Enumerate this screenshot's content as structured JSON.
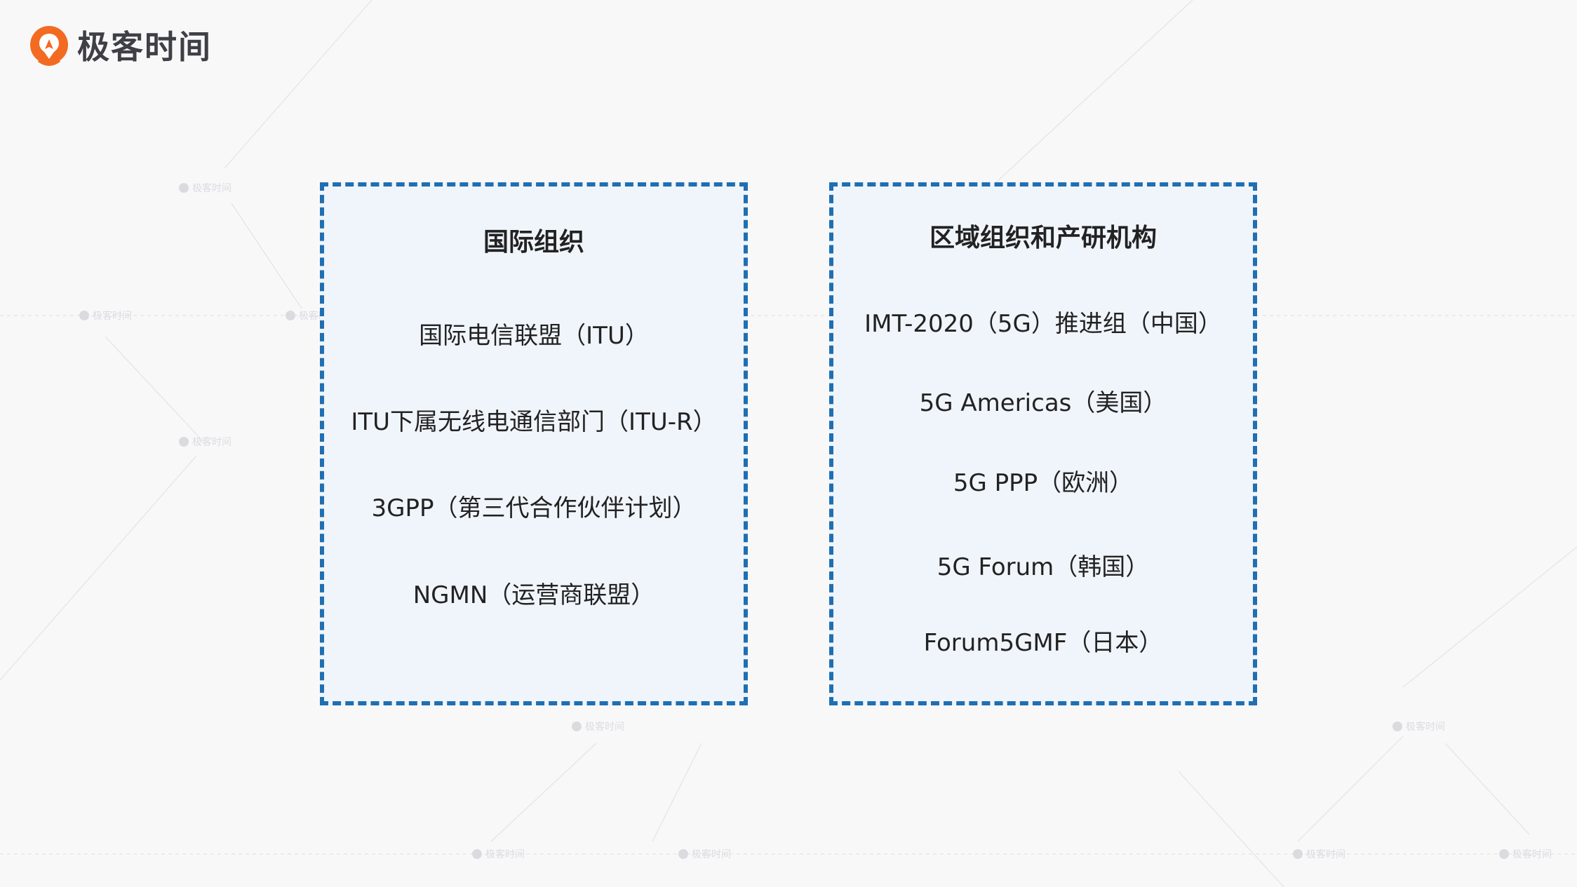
{
  "brand": {
    "name": "极客时间",
    "accent_color": "#f26b21"
  },
  "watermark_text": "极客时间",
  "left_box": {
    "title": "国际组织",
    "items": [
      "国际电信联盟（ITU）",
      "ITU下属无线电通信部门（ITU-R）",
      "3GPP（第三代合作伙伴计划）",
      "NGMN（运营商联盟）"
    ]
  },
  "right_box": {
    "title": "区域组织和产研机构",
    "items": [
      "IMT-2020（5G）推进组（中国）",
      "5G Americas（美国）",
      "5G PPP（欧洲）",
      "5G Forum（韩国）",
      "Forum5GMF（日本）"
    ]
  },
  "colors": {
    "box_border": "#1f6fb2",
    "box_fill": "#f0f5fb",
    "background": "#f9f8f9"
  }
}
